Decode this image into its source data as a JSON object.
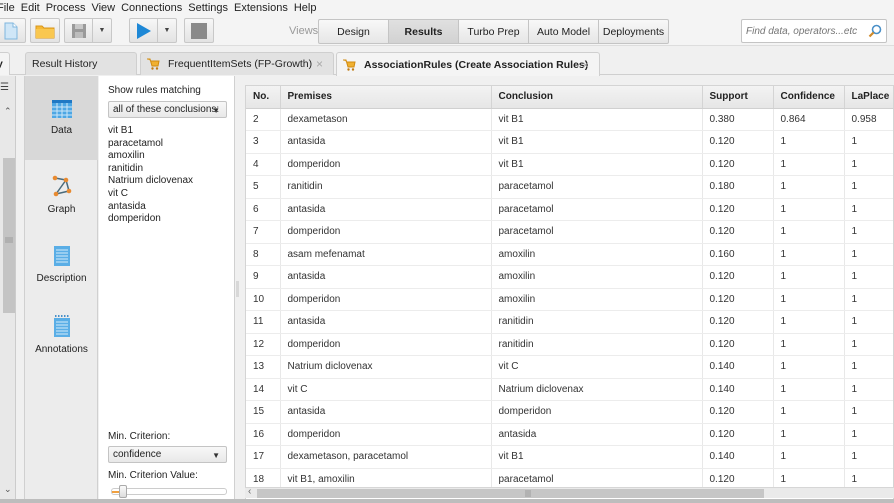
{
  "menu": [
    "File",
    "Edit",
    "Process",
    "View",
    "Connections",
    "Settings",
    "Extensions",
    "Help"
  ],
  "toolbar": {
    "new_icon": "new-file-icon",
    "open_icon": "folder-icon",
    "save_icon": "save-icon",
    "run_icon": "run-play-icon",
    "stop_icon": "stop-icon"
  },
  "views": {
    "label": "Views:",
    "items": [
      "Design",
      "Results",
      "Turbo Prep",
      "Auto Model",
      "Deployments"
    ],
    "active": "Results"
  },
  "search": {
    "placeholder": "Find data, operators...etc"
  },
  "left_panel_title_fragment": "y",
  "tabs": [
    {
      "label": "Result History"
    },
    {
      "label": "FrequentItemSets (FP-Growth)",
      "icon": "cart-icon",
      "close": "×"
    },
    {
      "label": "AssociationRules (Create Association Rules)",
      "icon": "cart-icon",
      "close": "×",
      "active": true
    }
  ],
  "sidenav": [
    {
      "label": "Data",
      "icon": "table-icon",
      "active": true
    },
    {
      "label": "Graph",
      "icon": "graph-icon"
    },
    {
      "label": "Description",
      "icon": "description-icon"
    },
    {
      "label": "Annotations",
      "icon": "annotations-icon"
    }
  ],
  "filter": {
    "show_label": "Show rules matching",
    "match_mode": "all of these conclusions:",
    "conclusions": [
      "vit B1",
      "paracetamol",
      "amoxilin",
      "ranitidin",
      "Natrium diclovenax",
      "vit C",
      "antasida",
      "domperidon"
    ],
    "min_criterion_label": "Min. Criterion:",
    "min_criterion": "confidence",
    "min_criterion_value_label": "Min. Criterion Value:",
    "min_criterion_value_fraction": 0.05
  },
  "table": {
    "columns": [
      "No.",
      "Premises",
      "Conclusion",
      "Support",
      "Confidence",
      "LaPlace"
    ],
    "rows": [
      [
        "2",
        "dexametason",
        "vit B1",
        "0.380",
        "0.864",
        "0.958"
      ],
      [
        "3",
        "antasida",
        "vit B1",
        "0.120",
        "1",
        "1"
      ],
      [
        "4",
        "domperidon",
        "vit B1",
        "0.120",
        "1",
        "1"
      ],
      [
        "5",
        "ranitidin",
        "paracetamol",
        "0.180",
        "1",
        "1"
      ],
      [
        "6",
        "antasida",
        "paracetamol",
        "0.120",
        "1",
        "1"
      ],
      [
        "7",
        "domperidon",
        "paracetamol",
        "0.120",
        "1",
        "1"
      ],
      [
        "8",
        "asam mefenamat",
        "amoxilin",
        "0.160",
        "1",
        "1"
      ],
      [
        "9",
        "antasida",
        "amoxilin",
        "0.120",
        "1",
        "1"
      ],
      [
        "10",
        "domperidon",
        "amoxilin",
        "0.120",
        "1",
        "1"
      ],
      [
        "11",
        "antasida",
        "ranitidin",
        "0.120",
        "1",
        "1"
      ],
      [
        "12",
        "domperidon",
        "ranitidin",
        "0.120",
        "1",
        "1"
      ],
      [
        "13",
        "Natrium diclovenax",
        "vit C",
        "0.140",
        "1",
        "1"
      ],
      [
        "14",
        "vit C",
        "Natrium diclovenax",
        "0.140",
        "1",
        "1"
      ],
      [
        "15",
        "antasida",
        "domperidon",
        "0.120",
        "1",
        "1"
      ],
      [
        "16",
        "domperidon",
        "antasida",
        "0.120",
        "1",
        "1"
      ],
      [
        "17",
        "dexametason, paracetamol",
        "vit B1",
        "0.140",
        "1",
        "1"
      ],
      [
        "18",
        "vit B1, amoxilin",
        "paracetamol",
        "0.120",
        "1",
        "1"
      ]
    ]
  },
  "colors": {
    "accent_blue": "#1e88d6",
    "cart_orange": "#e8a020",
    "graph_orange": "#e88a30"
  }
}
